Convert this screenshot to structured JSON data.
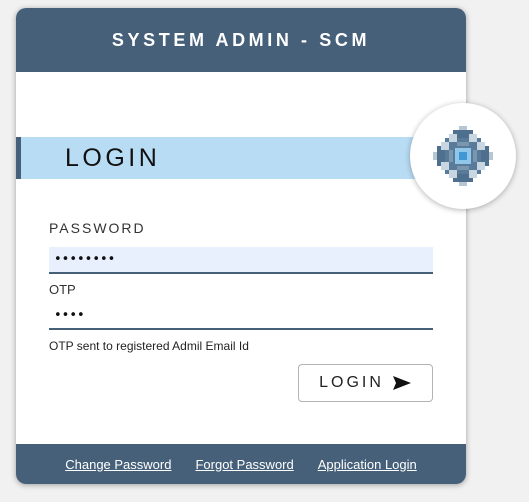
{
  "header": {
    "title": "SYSTEM ADMIN - SCM"
  },
  "login": {
    "title": "LOGIN"
  },
  "password": {
    "label": "PASSWORD",
    "value": "••••••••"
  },
  "otp": {
    "label": "OTP",
    "value": "••••",
    "hint": "OTP sent to registered Admil Email Id"
  },
  "login_button": {
    "label": "LOGIN",
    "icon": "send-icon"
  },
  "footer": {
    "links": [
      {
        "label": "Change Password"
      },
      {
        "label": "Forgot Password"
      },
      {
        "label": "Application Login"
      }
    ]
  },
  "logo": {
    "icon": "pixel-globe-logo-icon"
  },
  "colors": {
    "brand": "#46607a",
    "band": "#b8dcf4",
    "input_filled": "#e8f0fe"
  }
}
